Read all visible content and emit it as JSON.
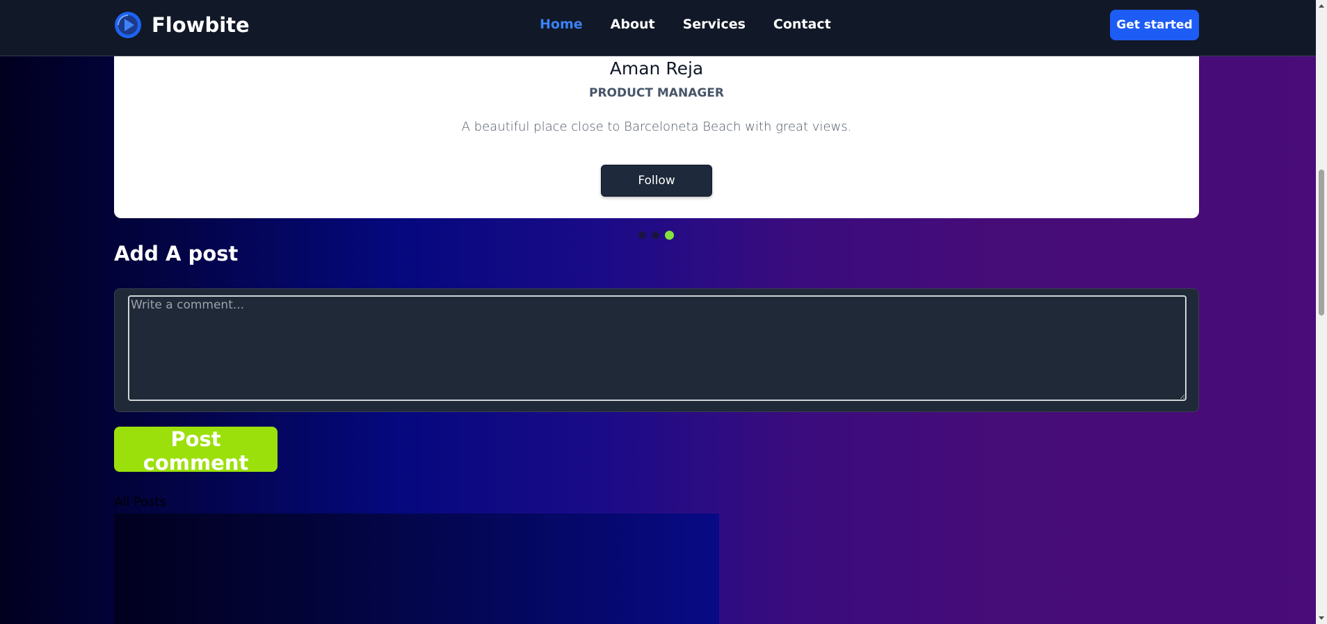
{
  "navbar": {
    "brand_name": "Flowbite",
    "links": [
      {
        "label": "Home",
        "active": true
      },
      {
        "label": "About",
        "active": false
      },
      {
        "label": "Services",
        "active": false
      },
      {
        "label": "Contact",
        "active": false
      }
    ],
    "cta_label": "Get started"
  },
  "profile": {
    "name": "Aman Reja",
    "role": "PRODUCT MANAGER",
    "description": "A beautiful place close to Barceloneta Beach with great views.",
    "follow_label": "Follow"
  },
  "carousel": {
    "slide_count": 3,
    "active_index": 2
  },
  "add_post": {
    "title": "Add A post",
    "textarea_placeholder": "Write a comment...",
    "textarea_value": "",
    "submit_label": "Post comment"
  },
  "posts": {
    "label": "All Posts"
  },
  "colors": {
    "navbar_bg": "#111827",
    "active_link": "#3b82f6",
    "cta_bg": "#1d5cf5",
    "post_button_bg": "#9be00a",
    "active_dot": "#84e23c"
  },
  "icons": {
    "brand": "flowbite-logo-icon"
  }
}
